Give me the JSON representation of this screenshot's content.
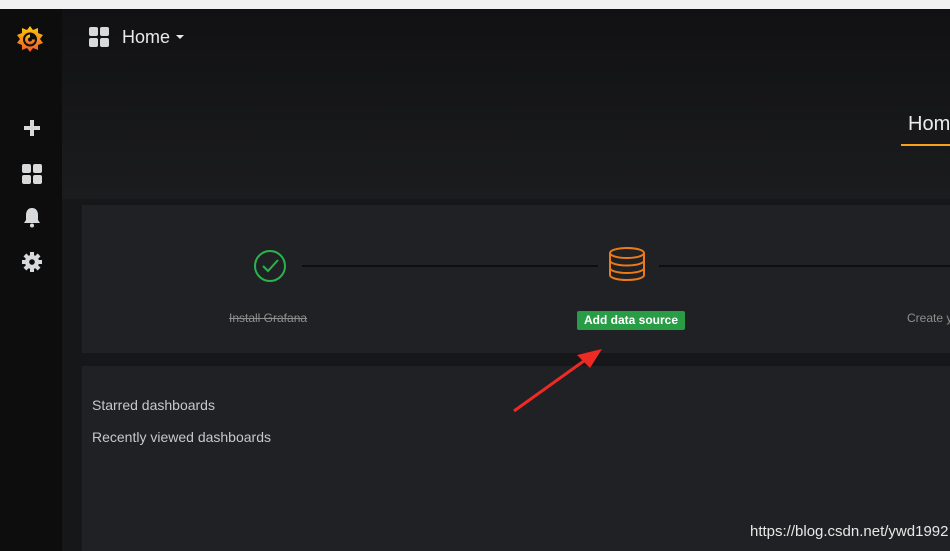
{
  "colors": {
    "accent": "#f9a11b",
    "success": "#299c46",
    "check_green": "#2bb24c",
    "arrow_red": "#ee2a24"
  },
  "sidebar": {
    "logo": "grafana-logo-icon",
    "items": [
      {
        "icon": "plus-icon"
      },
      {
        "icon": "dashboards-grid-icon"
      },
      {
        "icon": "bell-icon"
      },
      {
        "icon": "gear-icon"
      }
    ]
  },
  "header": {
    "dashboard_picker_label": "Home",
    "page_heading": "Hom"
  },
  "steps": {
    "install": {
      "label": "Install Grafana",
      "icon": "check-circle-icon"
    },
    "datasource": {
      "label": "Add data source",
      "icon": "database-icon"
    },
    "create": {
      "label": "Create y"
    }
  },
  "dashboards": {
    "starred": "Starred dashboards",
    "recent": "Recently viewed dashboards"
  },
  "watermark": "https://blog.csdn.net/ywd1992"
}
